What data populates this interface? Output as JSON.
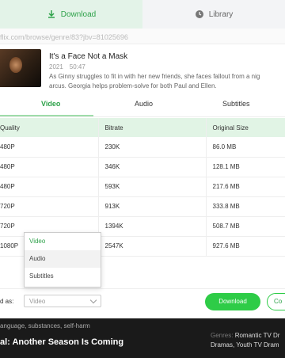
{
  "topbar": {
    "download_label": "Download",
    "library_label": "Library"
  },
  "url": "flix.com/browse/genre/83?jbv=81025696",
  "episode": {
    "title": "It's a Face Not a Mask",
    "year": "2021",
    "duration": "50:47",
    "description_line1": "As Ginny struggles to fit in with her new friends, she faces fallout from a nig",
    "description_line2": "arcus. Georgia helps problem-solve for both Paul and Ellen."
  },
  "tabs": {
    "video": "Video",
    "audio": "Audio",
    "subtitles": "Subtitles"
  },
  "table": {
    "headers": [
      "Quality",
      "Bitrate",
      "Original Size"
    ],
    "rows": [
      [
        "480P",
        "230K",
        "86.0 MB"
      ],
      [
        "480P",
        "346K",
        "128.1 MB"
      ],
      [
        "480P",
        "593K",
        "217.6 MB"
      ],
      [
        "720P",
        "913K",
        "333.8 MB"
      ],
      [
        "720P",
        "1394K",
        "508.7 MB"
      ],
      [
        "1080P",
        "2547K",
        "927.6 MB"
      ]
    ]
  },
  "dropdown": {
    "options": [
      "Video",
      "Audio",
      "Subtitles"
    ]
  },
  "footer": {
    "save_as_label": "d as:",
    "select_value": "Video",
    "download_button": "Download",
    "second_button": "Co"
  },
  "background": {
    "tags": "anguage, substances, self-harm",
    "title": "al: Another Season Is Coming",
    "genres_label": "Genres:",
    "genres_line1": "Romantic TV Dr",
    "genres_line2": "Dramas, Youth TV Dram"
  }
}
